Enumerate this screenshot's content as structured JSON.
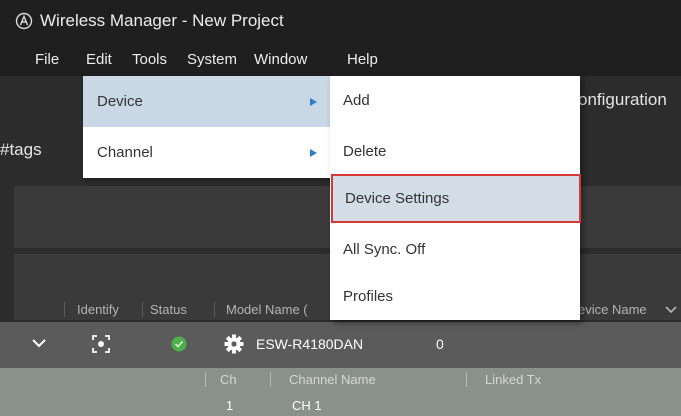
{
  "window": {
    "title": "Wireless Manager - New Project"
  },
  "menubar": {
    "items": [
      "File",
      "Edit",
      "Tools",
      "System",
      "Window",
      "Help"
    ]
  },
  "toolbar": {
    "partial_label": "onfiguration"
  },
  "tags": {
    "label": "#tags"
  },
  "device_menu": {
    "items": [
      {
        "label": "Device",
        "has_submenu": true,
        "active": true
      },
      {
        "label": "Channel",
        "has_submenu": true,
        "active": false
      }
    ]
  },
  "device_submenu": {
    "items": [
      {
        "label": "Add"
      },
      {
        "label": "Delete"
      },
      {
        "label": "Device Settings",
        "highlighted": true
      },
      {
        "label": "All Sync. Off"
      },
      {
        "label": "Profiles"
      }
    ]
  },
  "table": {
    "columns": [
      "Identify",
      "Status",
      "Model Name (",
      "evice Name"
    ],
    "device_row": {
      "model": "ESW-R4180DAN",
      "value": "0",
      "status_color": "#4cb04c"
    },
    "channel_table": {
      "columns": [
        "Ch",
        "Channel Name",
        "Linked Tx"
      ],
      "rows": [
        {
          "ch": "1",
          "name": "CH 1"
        }
      ]
    }
  },
  "colors": {
    "accent": "#2a7fcf",
    "highlight_border": "#d63838",
    "status_ok": "#4cb04c"
  }
}
